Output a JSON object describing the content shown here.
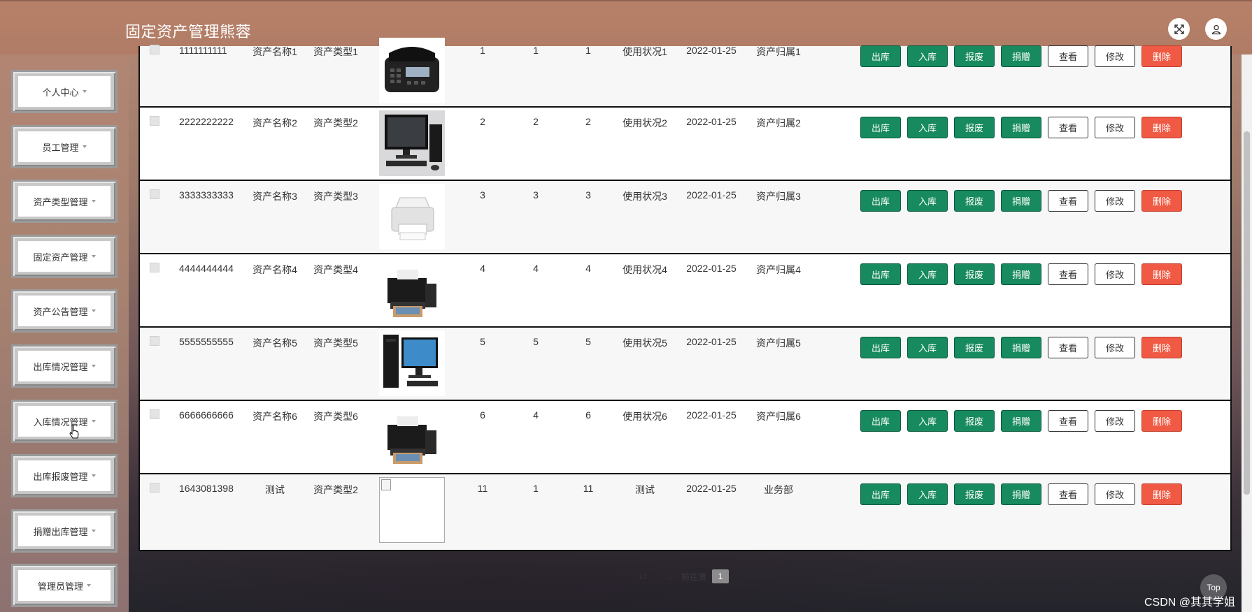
{
  "header": {
    "title": "固定资产管理熊蓉",
    "fullscreen_icon": "expand-icon",
    "user_icon": "user-icon"
  },
  "sidebar": {
    "items": [
      {
        "label": "个人中心"
      },
      {
        "label": "员工管理"
      },
      {
        "label": "资产类型管理"
      },
      {
        "label": "固定资产管理"
      },
      {
        "label": "资产公告管理"
      },
      {
        "label": "出库情况管理"
      },
      {
        "label": "入库情况管理"
      },
      {
        "label": "出库报废管理"
      },
      {
        "label": "捐赠出库管理"
      },
      {
        "label": "管理员管理"
      }
    ]
  },
  "table": {
    "rows": [
      {
        "code": "1111111111",
        "name": "资产名称1",
        "type": "资产类型1",
        "image": "desk-phone",
        "n1": "1",
        "n2": "1",
        "n3": "1",
        "status": "使用状况1",
        "date": "2022-01-25",
        "owner": "资产归属1"
      },
      {
        "code": "2222222222",
        "name": "资产名称2",
        "type": "资产类型2",
        "image": "desktop-computer",
        "n1": "2",
        "n2": "2",
        "n3": "2",
        "status": "使用状况2",
        "date": "2022-01-25",
        "owner": "资产归属2"
      },
      {
        "code": "3333333333",
        "name": "资产名称3",
        "type": "资产类型3",
        "image": "laser-printer",
        "n1": "3",
        "n2": "3",
        "n3": "3",
        "status": "使用状况3",
        "date": "2022-01-25",
        "owner": "资产归属3"
      },
      {
        "code": "4444444444",
        "name": "资产名称4",
        "type": "资产类型4",
        "image": "inkjet-printer",
        "n1": "4",
        "n2": "4",
        "n3": "4",
        "status": "使用状况4",
        "date": "2022-01-25",
        "owner": "资产归属4"
      },
      {
        "code": "5555555555",
        "name": "资产名称5",
        "type": "资产类型5",
        "image": "pc-monitor",
        "n1": "5",
        "n2": "5",
        "n3": "5",
        "status": "使用状况5",
        "date": "2022-01-25",
        "owner": "资产归属5"
      },
      {
        "code": "6666666666",
        "name": "资产名称6",
        "type": "资产类型6",
        "image": "inkjet-printer",
        "n1": "6",
        "n2": "4",
        "n3": "6",
        "status": "使用状况6",
        "date": "2022-01-25",
        "owner": "资产归属6"
      },
      {
        "code": "1643081398",
        "name": "测试",
        "type": "资产类型2",
        "image": "broken-image",
        "n1": "11",
        "n2": "1",
        "n3": "11",
        "status": "测试",
        "date": "2022-01-25",
        "owner": "业务部"
      }
    ],
    "actions": {
      "out": "出库",
      "in": "入库",
      "scrap": "报废",
      "donate": "捐赠",
      "view": "查看",
      "edit": "修改",
      "delete": "删除"
    }
  },
  "pagination": {
    "page_size": "10",
    "goto_text": "前往第",
    "current_page": "1"
  },
  "back_to_top": "Top",
  "watermark": "CSDN @其其学姐",
  "colors": {
    "header": "#b07c66",
    "action_green": "#178a5f",
    "delete_red": "#f05a44"
  }
}
